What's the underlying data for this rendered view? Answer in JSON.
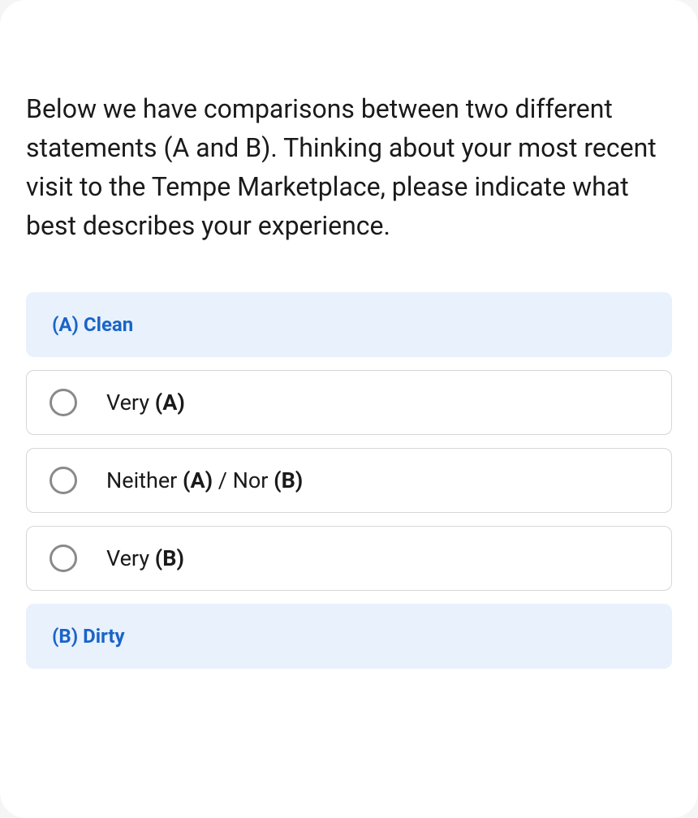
{
  "question": "Below we have comparisons between two different statements (A and B). Thinking about your most recent visit to the Tempe Marketplace, please indicate what best describes your experience.",
  "labelA": "(A) Clean",
  "labelB": "(B) Dirty",
  "options": [
    {
      "prefix": "Very ",
      "bold1": "(A)",
      "mid": "",
      "bold2": ""
    },
    {
      "prefix": "Neither ",
      "bold1": "(A)",
      "mid": " / Nor ",
      "bold2": "(B)"
    },
    {
      "prefix": "Very ",
      "bold1": "(B)",
      "mid": "",
      "bold2": ""
    }
  ]
}
